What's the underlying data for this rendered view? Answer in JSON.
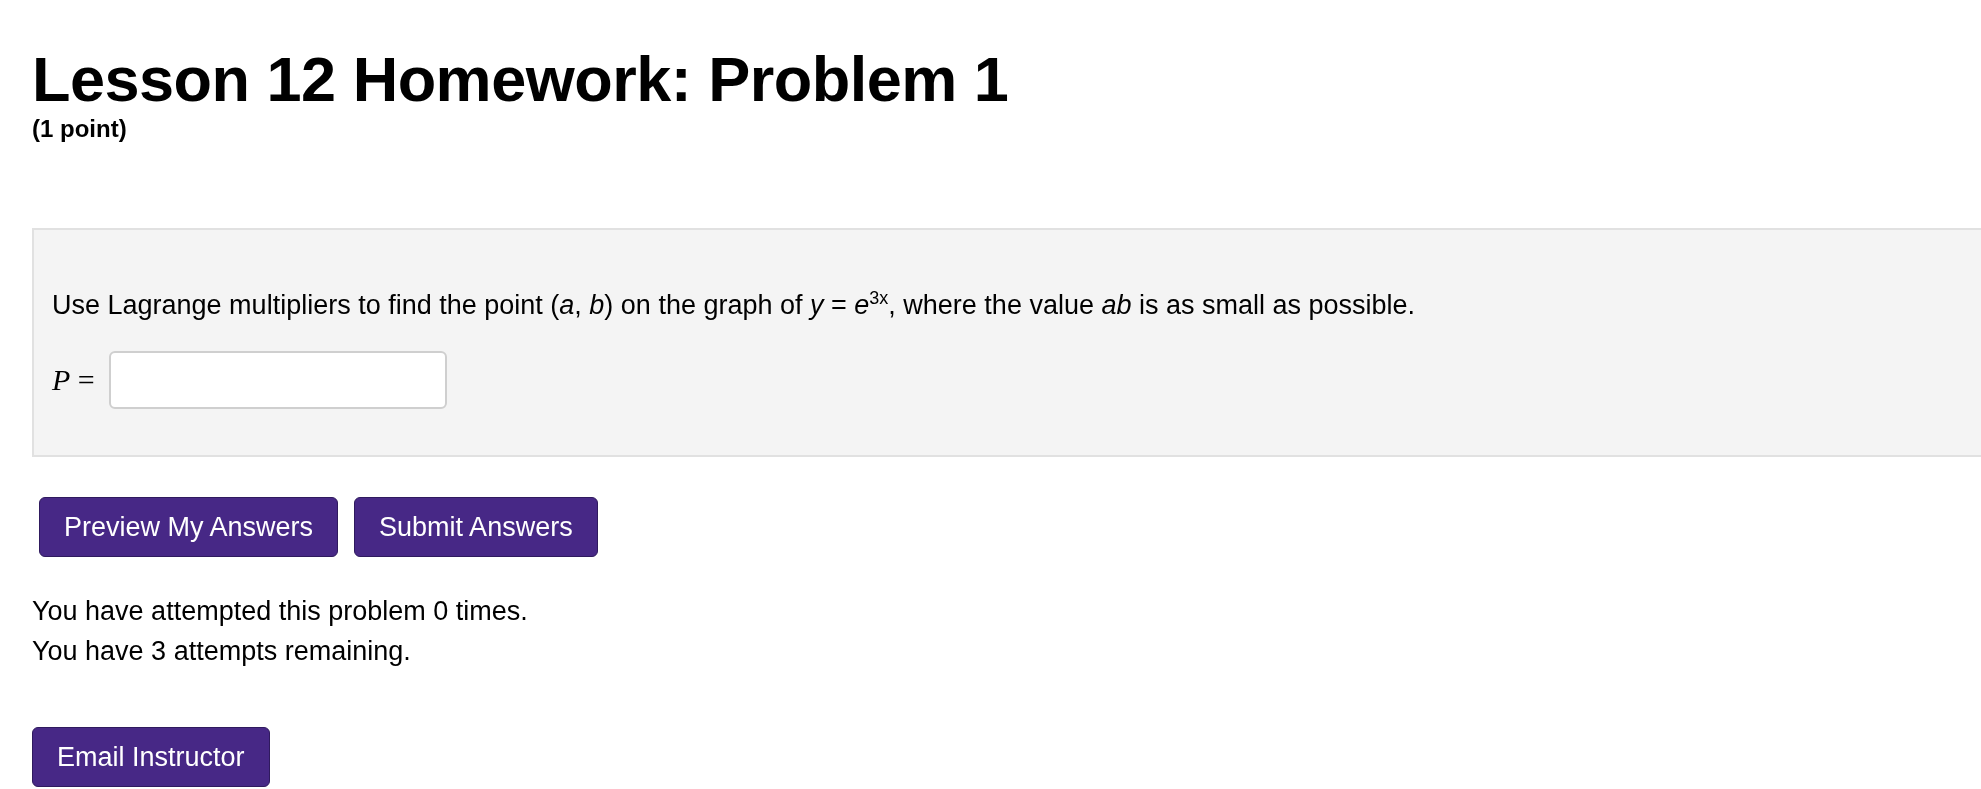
{
  "title": "Lesson 12 Homework: Problem 1",
  "points": "(1 point)",
  "problem": {
    "text": "Use Lagrange multipliers to find the point (*a*, *b*) on the graph of *y* = *e*$^{3x}$, where the value *ab* is as small as possible.",
    "answer_label": "*P* ="
  },
  "buttons": [
    {
      "label": "Preview My Answers"
    },
    {
      "label": "Submit Answers"
    }
  ],
  "attempts": [
    "You have attempted this problem 0 times.",
    "You have 3 attempts remaining."
  ],
  "email_button": {
    "label": "Email Instructor"
  }
}
